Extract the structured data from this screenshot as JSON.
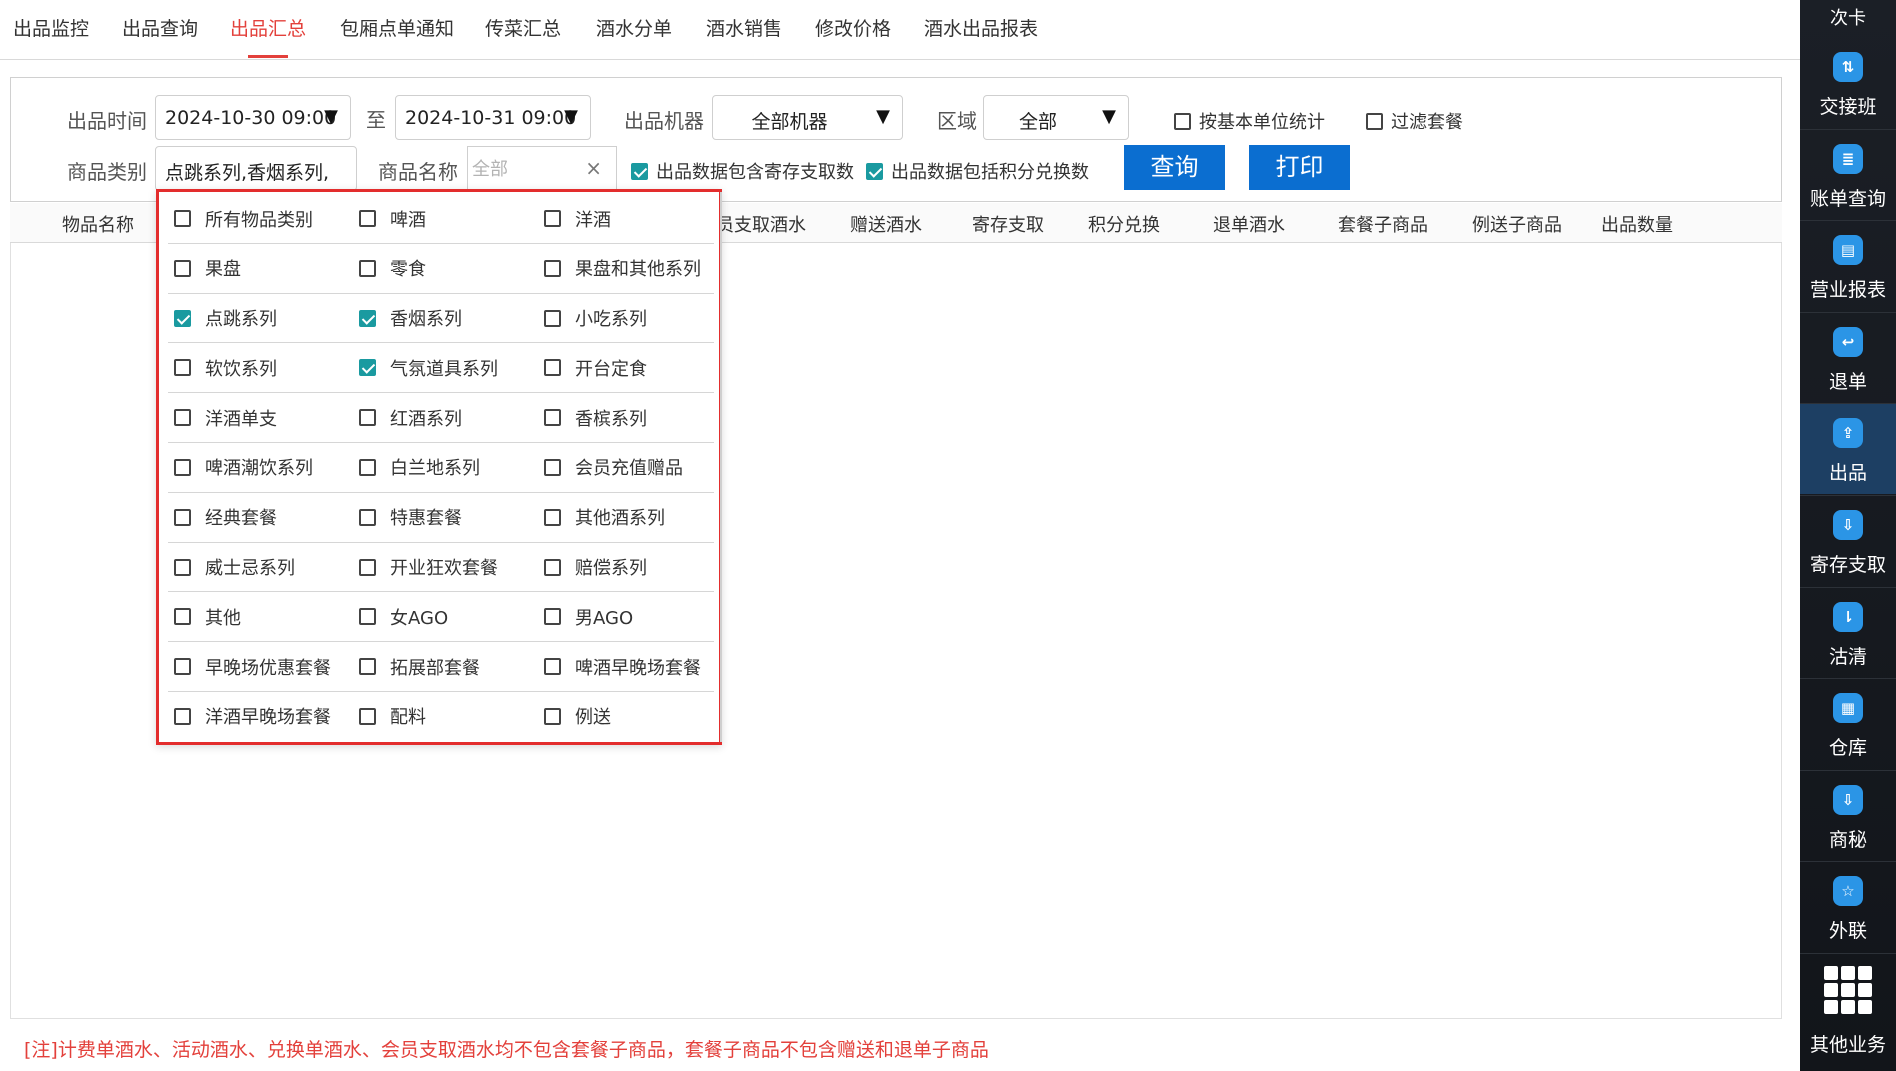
{
  "tabs": [
    {
      "label": "出品监控"
    },
    {
      "label": "出品查询"
    },
    {
      "label": "出品汇总"
    },
    {
      "label": "包厢点单通知"
    },
    {
      "label": "传菜汇总"
    },
    {
      "label": "酒水分单"
    },
    {
      "label": "酒水销售"
    },
    {
      "label": "修改价格"
    },
    {
      "label": "酒水出品报表"
    }
  ],
  "active_tab": "出品汇总",
  "filters": {
    "time_label": "出品时间",
    "time_start": "2024-10-30 09:00",
    "to_label": "至",
    "time_end": "2024-10-31 09:00",
    "machine_label": "出品机器",
    "machine_value": "全部机器",
    "area_label": "区域",
    "area_value": "全部",
    "base_unit_label": "按基本单位统计",
    "base_unit_checked": false,
    "filter_set_label": "过滤套餐",
    "filter_set_checked": false,
    "category_label": "商品类别",
    "category_value": "点跳系列,香烟系列,",
    "name_label": "商品名称",
    "name_placeholder": "全部",
    "clear_icon": "×",
    "include_storage_label": "出品数据包含寄存支取数",
    "include_storage_checked": true,
    "include_points_label": "出品数据包括积分兑换数",
    "include_points_checked": true,
    "query_button": "查询",
    "print_button": "打印",
    "dropdown_arrow": "▼"
  },
  "table": {
    "columns": [
      "物品名称",
      "会员支取酒水",
      "赠送酒水",
      "寄存支取",
      "积分兑换",
      "退单酒水",
      "套餐子商品",
      "例送子商品",
      "出品数量"
    ],
    "rows": []
  },
  "note": "[注]计费单酒水、活动酒水、兑换单酒水、会员支取酒水均不包含套餐子商品，套餐子商品不包含赠送和退单子商品",
  "category_popup": {
    "rows": [
      [
        {
          "label": "所有物品类别",
          "checked": false
        },
        {
          "label": "啤酒",
          "checked": false
        },
        {
          "label": "洋酒",
          "checked": false
        }
      ],
      [
        {
          "label": "果盘",
          "checked": false
        },
        {
          "label": "零食",
          "checked": false
        },
        {
          "label": "果盘和其他系列",
          "checked": false
        }
      ],
      [
        {
          "label": "点跳系列",
          "checked": true
        },
        {
          "label": "香烟系列",
          "checked": true
        },
        {
          "label": "小吃系列",
          "checked": false
        }
      ],
      [
        {
          "label": "软饮系列",
          "checked": false
        },
        {
          "label": "气氛道具系列",
          "checked": true
        },
        {
          "label": "开台定食",
          "checked": false
        }
      ],
      [
        {
          "label": "洋酒单支",
          "checked": false
        },
        {
          "label": "红酒系列",
          "checked": false
        },
        {
          "label": "香槟系列",
          "checked": false
        }
      ],
      [
        {
          "label": "啤酒潮饮系列",
          "checked": false
        },
        {
          "label": "白兰地系列",
          "checked": false
        },
        {
          "label": "会员充值赠品",
          "checked": false
        }
      ],
      [
        {
          "label": "经典套餐",
          "checked": false
        },
        {
          "label": "特惠套餐",
          "checked": false
        },
        {
          "label": "其他酒系列",
          "checked": false
        }
      ],
      [
        {
          "label": "威士忌系列",
          "checked": false
        },
        {
          "label": "开业狂欢套餐",
          "checked": false
        },
        {
          "label": "赔偿系列",
          "checked": false
        }
      ],
      [
        {
          "label": "其他",
          "checked": false
        },
        {
          "label": "女AGO",
          "checked": false
        },
        {
          "label": "男AGO",
          "checked": false
        }
      ],
      [
        {
          "label": "早晚场优惠套餐",
          "checked": false
        },
        {
          "label": "拓展部套餐",
          "checked": false
        },
        {
          "label": "啤酒早晚场套餐",
          "checked": false
        }
      ],
      [
        {
          "label": "洋酒早晚场套餐",
          "checked": false
        },
        {
          "label": "配料",
          "checked": false
        },
        {
          "label": "例送",
          "checked": false
        }
      ]
    ]
  },
  "sidebar": {
    "top_label": "次卡",
    "items": [
      {
        "label": "交接班",
        "icon": "handover-icon",
        "glyph": "⇅",
        "active": false
      },
      {
        "label": "账单查询",
        "icon": "bill-search-icon",
        "glyph": "≣",
        "active": false
      },
      {
        "label": "营业报表",
        "icon": "report-chart-icon",
        "glyph": "▤",
        "active": false
      },
      {
        "label": "退单",
        "icon": "refund-icon",
        "glyph": "↩",
        "active": false
      },
      {
        "label": "出品",
        "icon": "upload-icon",
        "glyph": "⇪",
        "active": true
      },
      {
        "label": "寄存支取",
        "icon": "download-icon",
        "glyph": "⇩",
        "active": false
      },
      {
        "label": "沽清",
        "icon": "sort-icon",
        "glyph": "⇂",
        "active": false
      },
      {
        "label": "仓库",
        "icon": "warehouse-icon",
        "glyph": "▦",
        "active": false
      },
      {
        "label": "商秘",
        "icon": "download-icon",
        "glyph": "⇩",
        "active": false
      },
      {
        "label": "外联",
        "icon": "contact-icon",
        "glyph": "☆",
        "active": false
      }
    ],
    "more_label": "其他业务"
  }
}
